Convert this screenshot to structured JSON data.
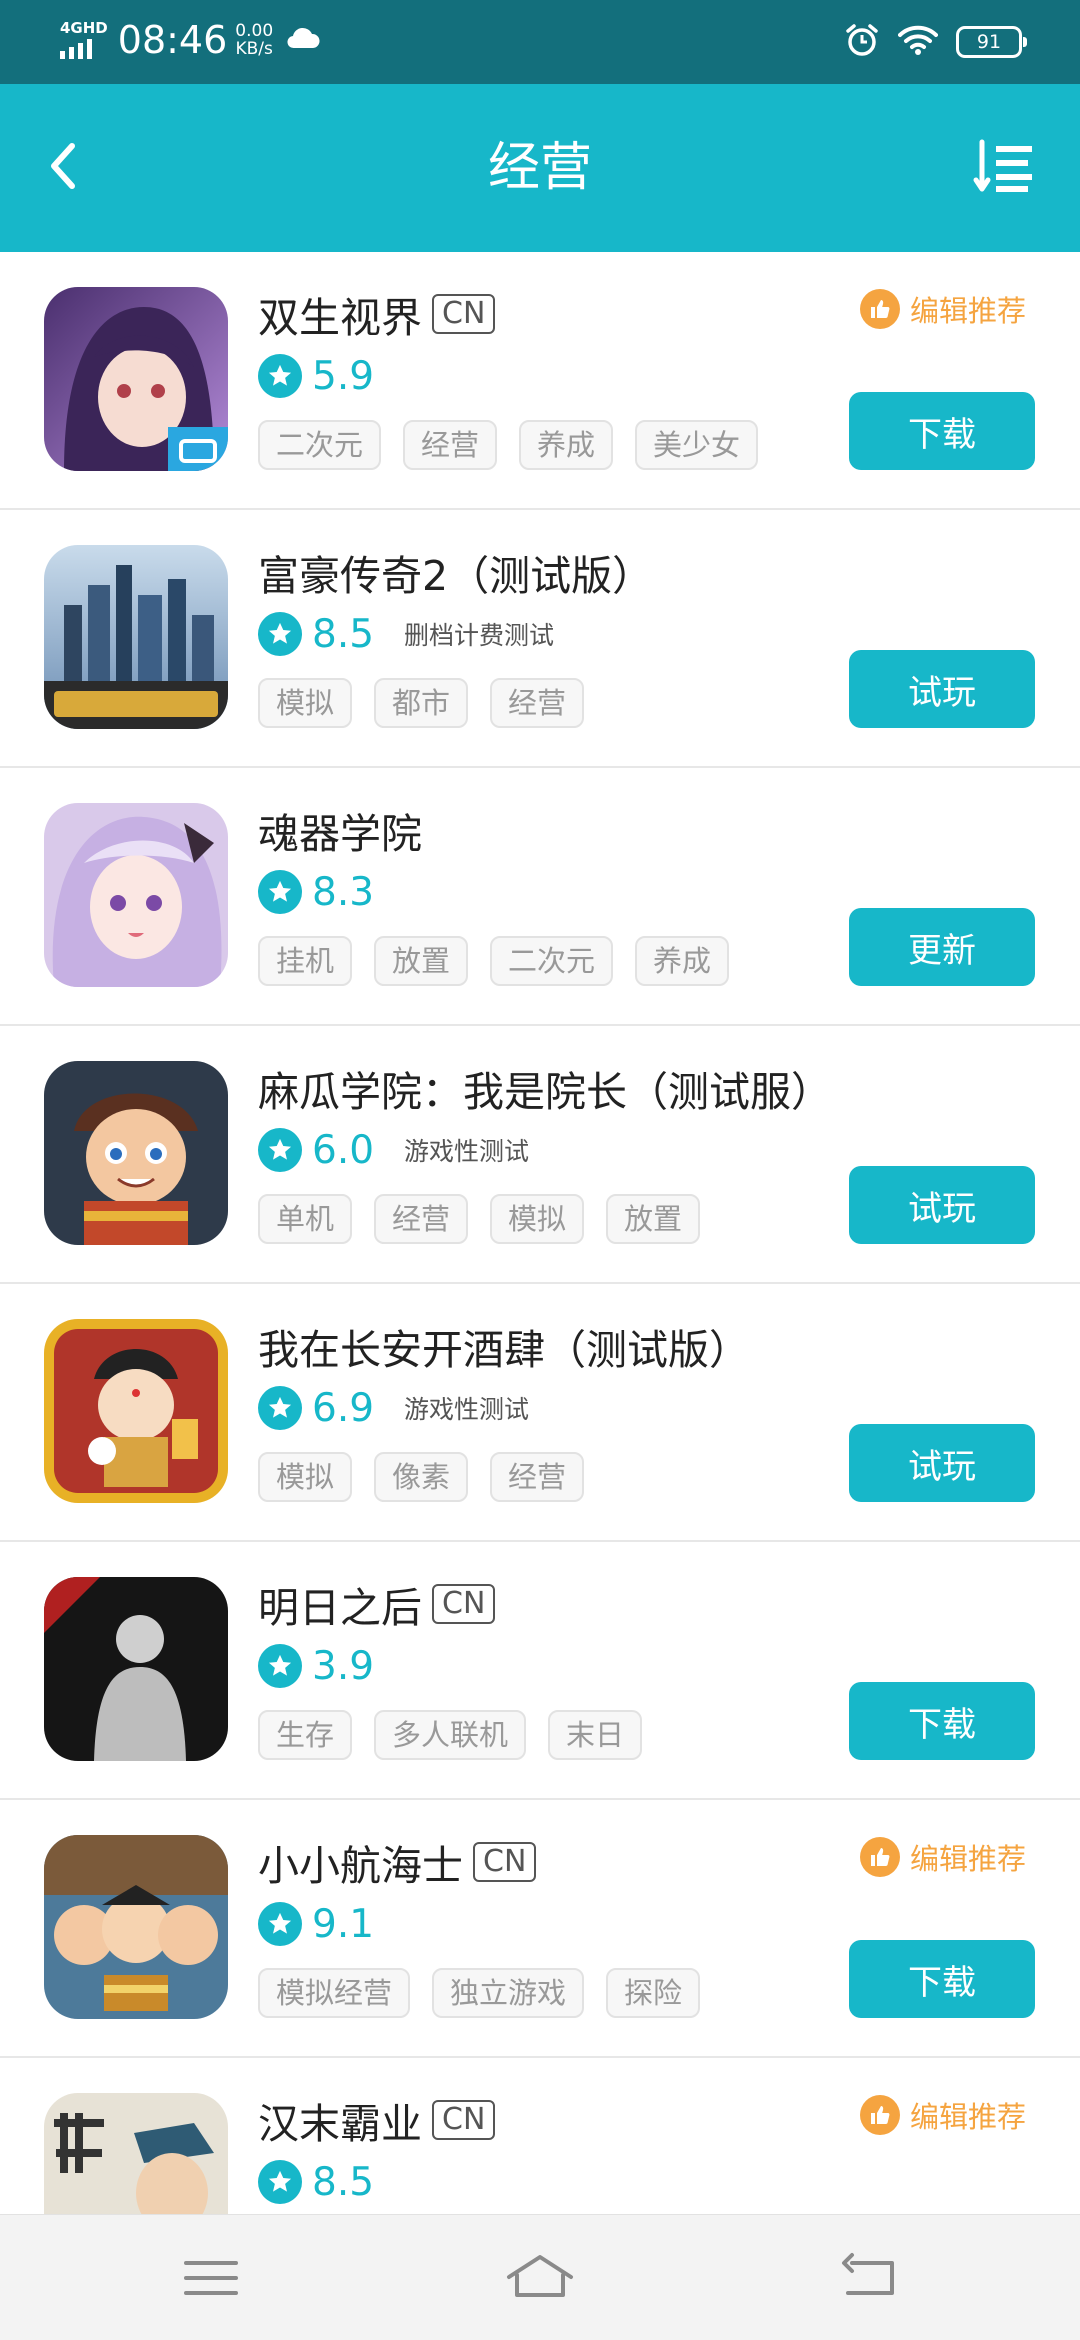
{
  "status_bar": {
    "network": "4GHD",
    "time": "08:46",
    "speed_value": "0.00",
    "speed_unit": "KB/s",
    "battery": "91",
    "icons": [
      "signal-icon",
      "cloud-icon",
      "alarm-icon",
      "wifi-icon",
      "battery-icon"
    ]
  },
  "header": {
    "title": "经营",
    "back_icon": "chevron-left-icon",
    "sort_icon": "sort-list-icon"
  },
  "colors": {
    "accent": "#17b7c9",
    "status_bar": "#136f7c",
    "recommend": "#f5a440",
    "tag_text": "#999999"
  },
  "apps": [
    {
      "name": "双生视界",
      "badge": "CN",
      "score": "5.9",
      "note": "",
      "tags": [
        "二次元",
        "经营",
        "养成",
        "美少女"
      ],
      "recommend": "编辑推荐",
      "button": "下载"
    },
    {
      "name": "富豪传奇2（测试版）",
      "badge": "",
      "score": "8.5",
      "note": "删档计费测试",
      "tags": [
        "模拟",
        "都市",
        "经营"
      ],
      "recommend": "",
      "button": "试玩"
    },
    {
      "name": "魂器学院",
      "badge": "",
      "score": "8.3",
      "note": "",
      "tags": [
        "挂机",
        "放置",
        "二次元",
        "养成"
      ],
      "recommend": "",
      "button": "更新"
    },
    {
      "name": "麻瓜学院：我是院长（测试服）",
      "badge": "",
      "score": "6.0",
      "note": "游戏性测试",
      "tags": [
        "单机",
        "经营",
        "模拟",
        "放置"
      ],
      "recommend": "",
      "button": "试玩"
    },
    {
      "name": "我在长安开酒肆（测试版）",
      "badge": "",
      "score": "6.9",
      "note": "游戏性测试",
      "tags": [
        "模拟",
        "像素",
        "经营"
      ],
      "recommend": "",
      "button": "试玩"
    },
    {
      "name": "明日之后",
      "badge": "CN",
      "score": "3.9",
      "note": "",
      "tags": [
        "生存",
        "多人联机",
        "末日"
      ],
      "recommend": "",
      "button": "下载"
    },
    {
      "name": "小小航海士",
      "badge": "CN",
      "score": "9.1",
      "note": "",
      "tags": [
        "模拟经营",
        "独立游戏",
        "探险"
      ],
      "recommend": "编辑推荐",
      "button": "下载"
    },
    {
      "name": "汉末霸业",
      "badge": "CN",
      "score": "8.5",
      "note": "",
      "tags": [],
      "recommend": "编辑推荐",
      "button": ""
    }
  ],
  "nav": {
    "icons": [
      "menu-icon",
      "home-icon",
      "back-icon"
    ]
  }
}
